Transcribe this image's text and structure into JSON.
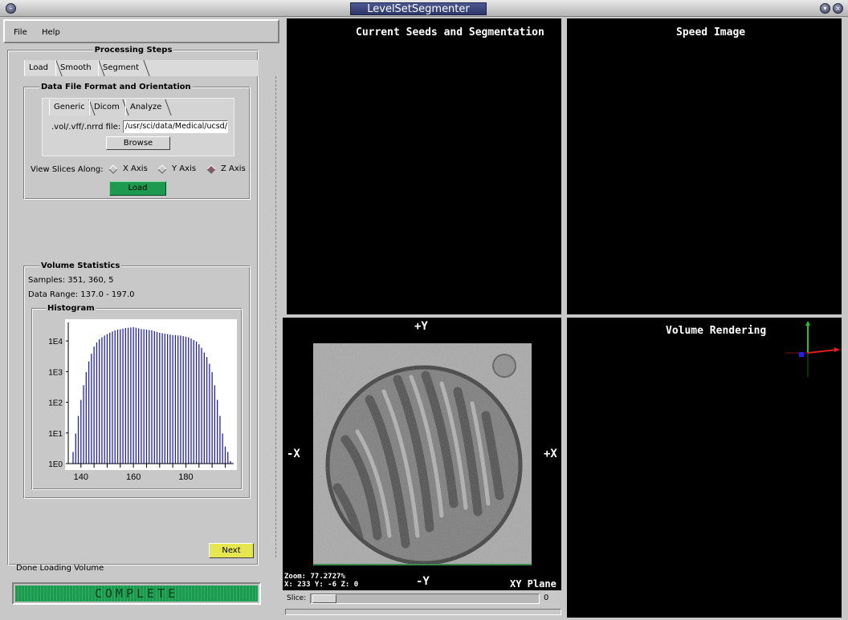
{
  "window": {
    "title": "LevelSetSegmenter"
  },
  "menu": {
    "file": "File",
    "help": "Help"
  },
  "processing": {
    "label": "Processing Steps",
    "tabs": [
      "Load",
      "Smooth",
      "Segment"
    ]
  },
  "data_file": {
    "label": "Data File Format and Orientation",
    "tabs": [
      "Generic",
      "Dicom",
      "Analyze"
    ],
    "file_label": ".vol/.vff/.nrrd file:",
    "file_value": "/usr/sci/data/Medical/ucsd/ki",
    "browse_label": "Browse",
    "view_label": "View Slices Along:",
    "axes": [
      "X Axis",
      "Y Axis",
      "Z Axis"
    ],
    "selected_axis": "Z Axis",
    "load_label": "Load"
  },
  "volume_stats": {
    "label": "Volume Statistics",
    "samples": "Samples: 351, 360, 5",
    "range": "Data Range: 137.0 - 197.0",
    "histogram_label": "Histogram"
  },
  "chart_data": {
    "type": "bar",
    "title": "Histogram",
    "y_scale": "log",
    "y_ticks": [
      "1E0",
      "1E1",
      "1E2",
      "1E3",
      "1E4"
    ],
    "x_ticks": [
      "140",
      "160",
      "180"
    ],
    "xlim": [
      137,
      197
    ],
    "x": [
      137,
      138,
      139,
      140,
      141,
      142,
      143,
      144,
      145,
      146,
      147,
      148,
      149,
      150,
      151,
      152,
      153,
      154,
      155,
      156,
      157,
      158,
      159,
      160,
      161,
      162,
      163,
      164,
      165,
      166,
      167,
      168,
      169,
      170,
      171,
      172,
      173,
      174,
      175,
      176,
      177,
      178,
      179,
      180,
      181,
      182,
      183,
      184,
      185,
      186,
      187,
      188,
      189,
      190,
      191,
      192,
      193,
      194,
      195,
      196,
      197
    ],
    "values": [
      2,
      8,
      30,
      100,
      300,
      800,
      1800,
      3200,
      5500,
      7500,
      9500,
      11000,
      12500,
      14000,
      15500,
      17000,
      18500,
      19500,
      20000,
      21000,
      22000,
      22500,
      23000,
      23500,
      22500,
      21500,
      20500,
      20000,
      19500,
      19000,
      18500,
      17500,
      16500,
      15500,
      15000,
      14500,
      14000,
      13500,
      13000,
      13000,
      12500,
      12500,
      12000,
      11500,
      11000,
      10000,
      9000,
      8000,
      6500,
      5000,
      3500,
      2500,
      1500,
      800,
      300,
      100,
      30,
      8,
      3,
      2,
      1
    ]
  },
  "nav": {
    "next_label": "Next"
  },
  "status": {
    "text": "Done Loading Volume",
    "progress_label": "COMPLETE",
    "progress": 1.0
  },
  "views": {
    "seeds_title": "Current Seeds and Segmentation",
    "speed_title": "Speed Image",
    "render_title": "Volume Rendering",
    "plus_y": "+Y",
    "minus_y": "-Y",
    "plus_x": "+X",
    "minus_x": "-X",
    "zoom": "Zoom: 77.2727%",
    "coords": "X: 233 Y: -6 Z: 0",
    "plane": "XY Plane",
    "slice_label": "Slice:",
    "slice_value": "0",
    "slice_fraction": 0
  },
  "colors": {
    "accent_green": "#1e9a50",
    "next_yellow": "#e6e650",
    "title_blue": "#3a4478"
  }
}
